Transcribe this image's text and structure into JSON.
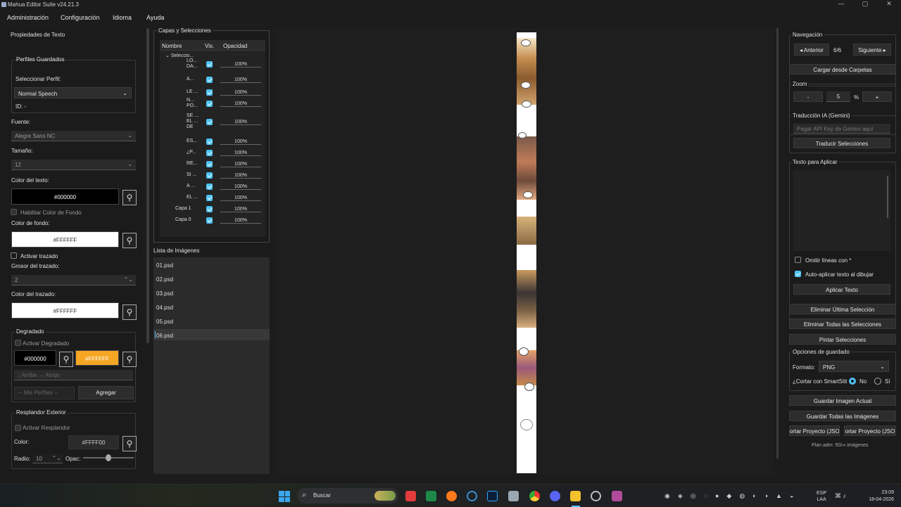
{
  "window": {
    "title": "Mahua Editor Suite v24.21.3",
    "min": "—",
    "max": "▢",
    "close": "✕"
  },
  "menu": [
    "Administración",
    "Configuración",
    "Idioma",
    "Ayuda"
  ],
  "left": {
    "title": "Propiedades de Texto",
    "profiles_group": "Perfiles Guardados",
    "select_profile_label": "Seleccionar Perfil:",
    "profile_value": "Normal Speech",
    "id_label": "ID: -",
    "font_label": "Fuente:",
    "font_value": "Alegre Sans NC",
    "size_label": "Tamaño:",
    "size_value": "12",
    "text_color_label": "Color del texto:",
    "text_color_value": "#000000",
    "enable_bg_label": "Habilitar Color de Fondo",
    "bg_color_label": "Color de fondo:",
    "bg_color_value": "#FFFFFF",
    "stroke_enable_label": "Activar trazado",
    "stroke_width_label": "Grosor del trazado:",
    "stroke_width_value": "2",
    "stroke_color_label": "Color del trazado:",
    "stroke_color_value": "#FFFFFF",
    "gradient_group": "Degradado",
    "gradient_enable": "Activar Degradado",
    "gradient_c1": "#000000",
    "gradient_c2": "#FFFFFF",
    "gradient_dir": "↓ Arriba → Abajo",
    "my_profiles": "-- Mis Perfiles --",
    "add_btn": "Agregar",
    "glow_group": "Resplandor Exterior",
    "glow_enable": "Activar Resplandor",
    "glow_color_label": "Color:",
    "glow_color_value": "#FFFF00",
    "radius_label": "Radio:",
    "radius_value": "10",
    "opacity_label": "Opac:"
  },
  "layers": {
    "title": "Capas y Selecciones",
    "headers": [
      "Nombre",
      "Vis.",
      "Opacidad"
    ],
    "root": "Seleccio...",
    "rows": [
      {
        "name": "LO...\nDA...",
        "opacity": "100%"
      },
      {
        "name": "A...",
        "opacity": "100%"
      },
      {
        "name": "LE ...",
        "opacity": "100%"
      },
      {
        "name": "N...\nPO...",
        "opacity": "100%"
      },
      {
        "name": "SE ...\nEL ...\nDE",
        "opacity": "100%"
      },
      {
        "name": "ES...",
        "opacity": "100%"
      },
      {
        "name": "¿P...",
        "opacity": "100%"
      },
      {
        "name": "RE...",
        "opacity": "100%"
      },
      {
        "name": "SI ...",
        "opacity": "100%"
      },
      {
        "name": "A ...",
        "opacity": "100%"
      },
      {
        "name": "EL ...",
        "opacity": "100%"
      },
      {
        "name": "Capa 1",
        "opacity": "100%"
      },
      {
        "name": "Capa 0",
        "opacity": "100%"
      }
    ]
  },
  "images": {
    "title": "Lista de Imágenes",
    "items": [
      "01.psd",
      "02.psd",
      "03.psd",
      "04.psd",
      "05.psd",
      "06.psd"
    ],
    "selected": "06.psd"
  },
  "right": {
    "nav_group": "Navegación",
    "prev": "◂ Anterior",
    "page": "6/6",
    "next": "Siguiente ▸",
    "load_folders": "Cargar desde Carpetas",
    "zoom_group": "Zoom",
    "zoom_minus": "-",
    "zoom_value": "5",
    "zoom_pct": "%",
    "zoom_plus": "+",
    "ai_group": "Traducción IA (Gemini)",
    "api_placeholder": "Pegar API Key de Gemini aquí",
    "translate_btn": "Traducir Selecciones",
    "apply_group": "Texto para Aplicar",
    "omit_lines": "Omitir líneas con *",
    "auto_apply": "Auto-aplicar texto al dibujar",
    "apply_btn": "Aplicar Texto",
    "del_last": "Eliminar Última Selección",
    "del_all": "Eliminar Todas las Selecciones",
    "paint": "Pintar Selecciones",
    "save_group": "Opciones de guardado",
    "format_label": "Formato:",
    "format_value": "PNG",
    "cut_label": "¿Cortar con SmartStit",
    "no": "No",
    "si": "Sí",
    "save_current": "Guardar Imagen Actual",
    "save_all": "Guardar Todas las Imágenes",
    "export1": "ortar Proyecto (JSO",
    "export2": "ortar Proyecto (JSO",
    "plan": "Plan adm: 50/∞ imágenes"
  },
  "taskbar": {
    "search": "Buscar",
    "lang1": "ESP",
    "lang2": "LAA",
    "time": "23:09",
    "date": "18-04-2026"
  },
  "colors": {
    "accent": "#4ec3f5",
    "gradient2": "#f5a623"
  }
}
